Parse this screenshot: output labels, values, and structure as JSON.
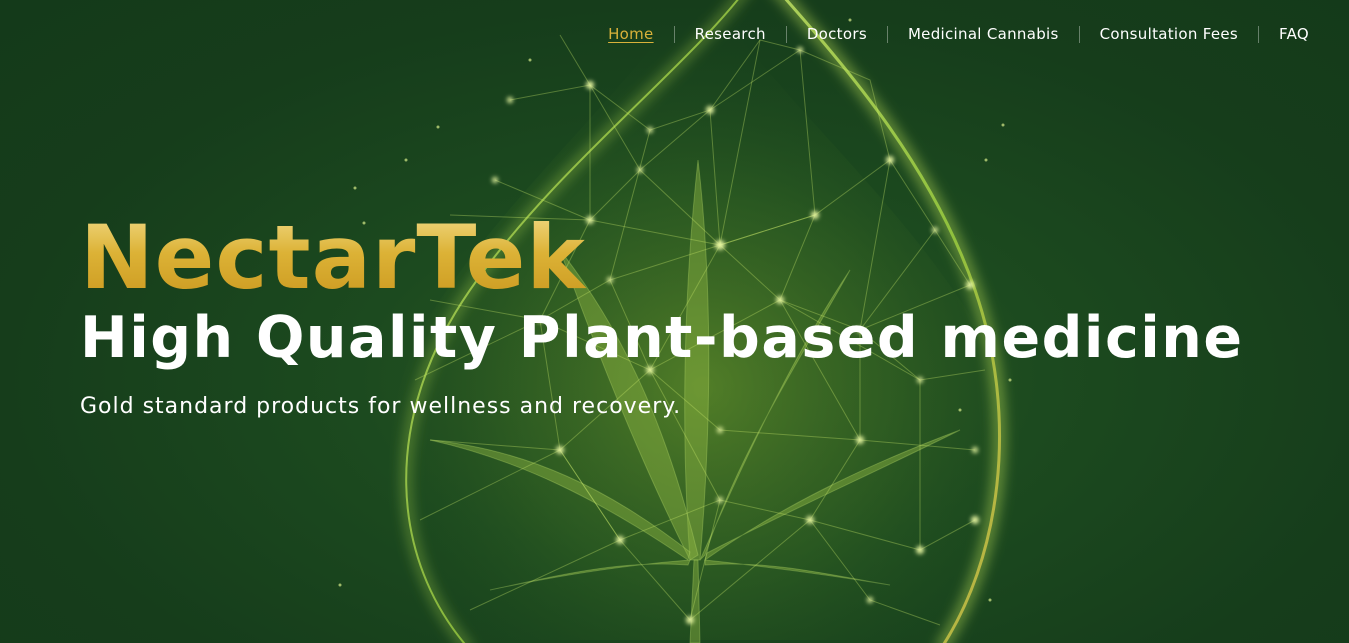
{
  "nav": {
    "items": [
      {
        "label": "Home",
        "active": true
      },
      {
        "label": "Research",
        "active": false
      },
      {
        "label": "Doctors",
        "active": false
      },
      {
        "label": "Medicinal Cannabis",
        "active": false
      },
      {
        "label": "Consultation Fees",
        "active": false
      },
      {
        "label": "FAQ",
        "active": false
      }
    ]
  },
  "hero": {
    "brand": "NectarTek",
    "headline": "High Quality Plant-based medicine",
    "tagline": "Gold standard products for wellness and recovery.",
    "background_image": "cannabis-leaf-in-network-droplet"
  },
  "colors": {
    "background": "#163d1b",
    "brand_gold": "#d9b23a",
    "text": "#ffffff",
    "network_glow": "#b8e05a"
  }
}
